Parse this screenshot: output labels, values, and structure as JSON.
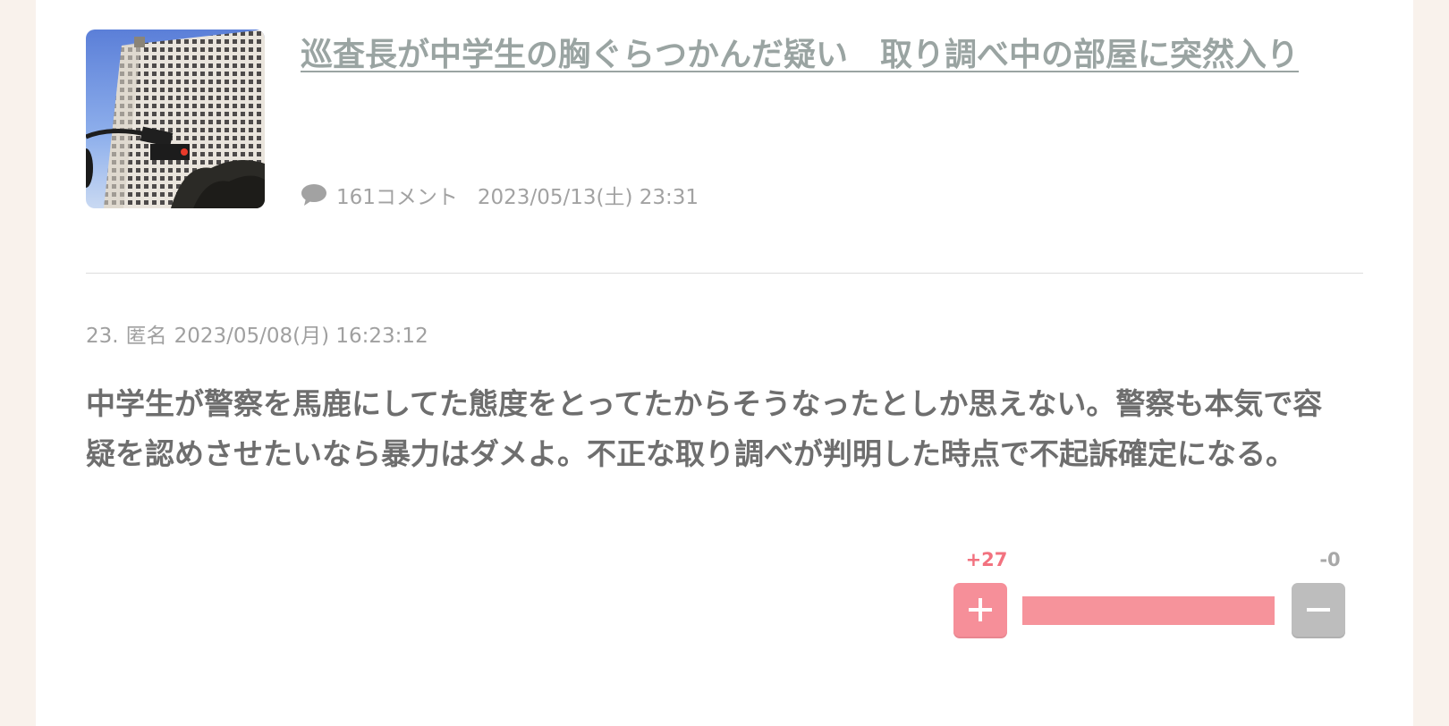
{
  "article": {
    "title": "巡査長が中学生の胸ぐらつかんだ疑い　取り調べ中の部屋に突然入り",
    "comment_count": "161コメント",
    "datetime": "2023/05/13(土) 23:31",
    "thumbnail_icon": "building-photo"
  },
  "comment": {
    "number": "23.",
    "author": "匿名",
    "datetime": "2023/05/08(月) 16:23:12",
    "body": "中学生が警察を馬鹿にしてた態度をとってたからそうなったとしか思えない。警察も本気で容疑を認めさせたいなら暴力はダメよ。不正な取り調べが判明した時点で不起訴確定になる。"
  },
  "vote": {
    "plus_count": "+27",
    "minus_count": "-0",
    "plus_ratio": 1.0,
    "plus_icon": "plus-icon",
    "minus_icon": "minus-icon"
  },
  "colors": {
    "title": "#9aa4a2",
    "plus": "#f68f99",
    "minus": "#bdbdbd",
    "background": "#f9f2ec"
  }
}
